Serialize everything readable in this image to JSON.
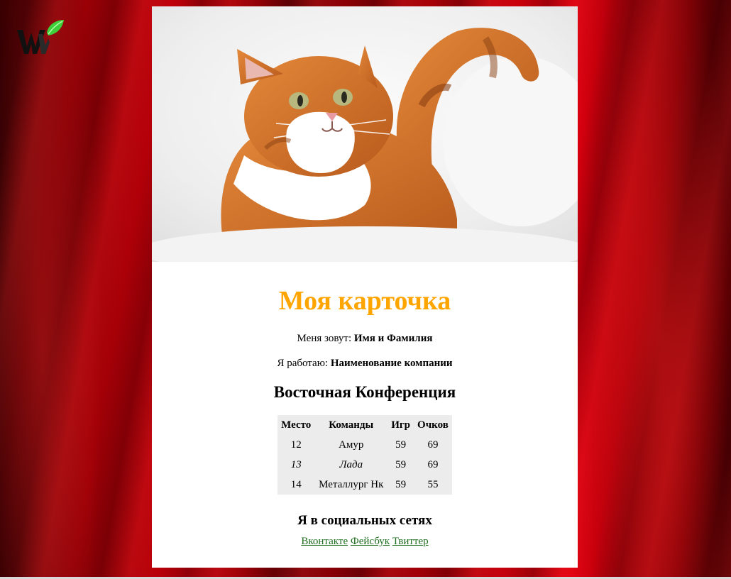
{
  "card": {
    "title": "Моя карточка",
    "name_label": "Меня зовут: ",
    "name_value": "Имя и Фамилия",
    "work_label": "Я работаю: ",
    "work_value": "Наименование компании",
    "conference_title": "Восточная Конференция"
  },
  "table": {
    "headers": [
      "Место",
      "Команды",
      "Игр",
      "Очков"
    ],
    "rows": [
      [
        "12",
        "Амур",
        "59",
        "69"
      ],
      [
        "13",
        "Лада",
        "59",
        "69"
      ],
      [
        "14",
        "Металлург Нк",
        "59",
        "55"
      ]
    ]
  },
  "social": {
    "title": "Я в социальных сетях",
    "links": [
      "Вконтакте",
      "Фейсбук",
      "Твиттер"
    ]
  },
  "colors": {
    "title": "#ffa500",
    "link": "#1f6e1f",
    "table_bg": "#ececec"
  },
  "icons": {
    "logo": "w-leaf-logo",
    "photo": "ginger-cat-photo"
  }
}
